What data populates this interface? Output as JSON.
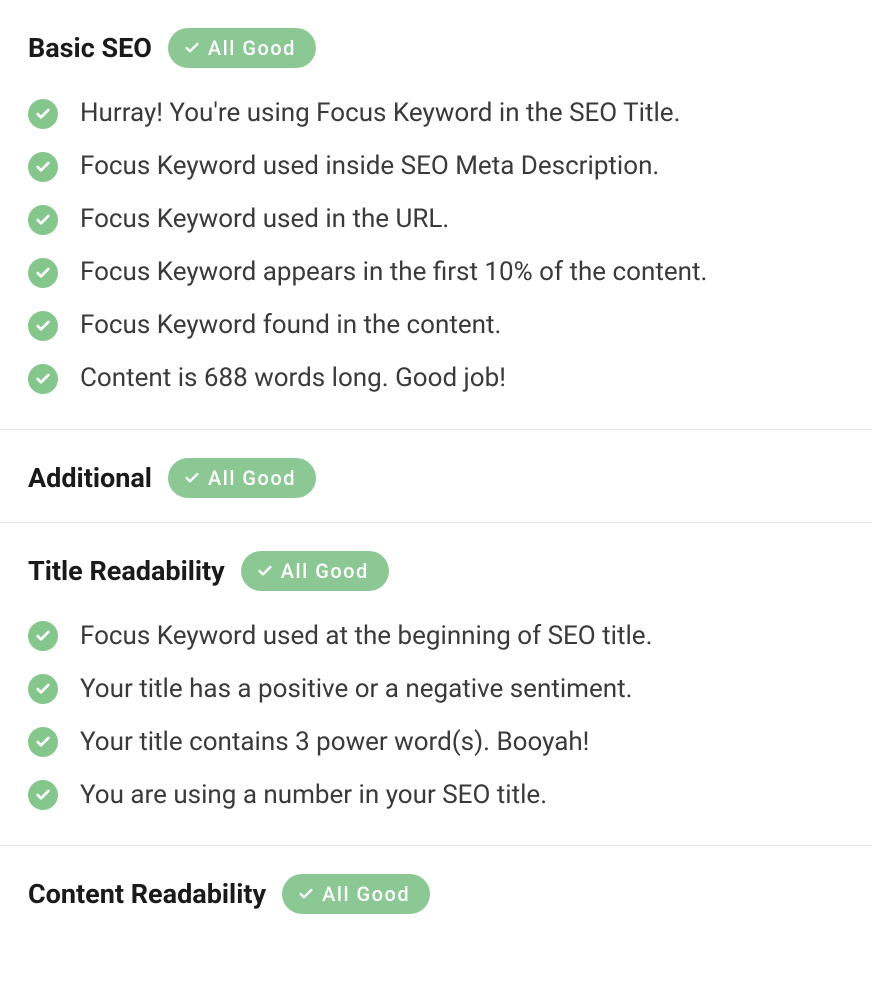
{
  "sections": {
    "basic_seo": {
      "title": "Basic SEO",
      "badge": "All Good",
      "items": [
        "Hurray! You're using Focus Keyword in the SEO Title.",
        "Focus Keyword used inside SEO Meta Description.",
        "Focus Keyword used in the URL.",
        "Focus Keyword appears in the first 10% of the content.",
        "Focus Keyword found in the content.",
        "Content is 688 words long. Good job!"
      ]
    },
    "additional": {
      "title": "Additional",
      "badge": "All Good"
    },
    "title_readability": {
      "title": "Title Readability",
      "badge": "All Good",
      "items": [
        "Focus Keyword used at the beginning of SEO title.",
        "Your title has a positive or a negative sentiment.",
        "Your title contains 3 power word(s). Booyah!",
        "You are using a number in your SEO title."
      ]
    },
    "content_readability": {
      "title": "Content Readability",
      "badge": "All Good"
    }
  }
}
